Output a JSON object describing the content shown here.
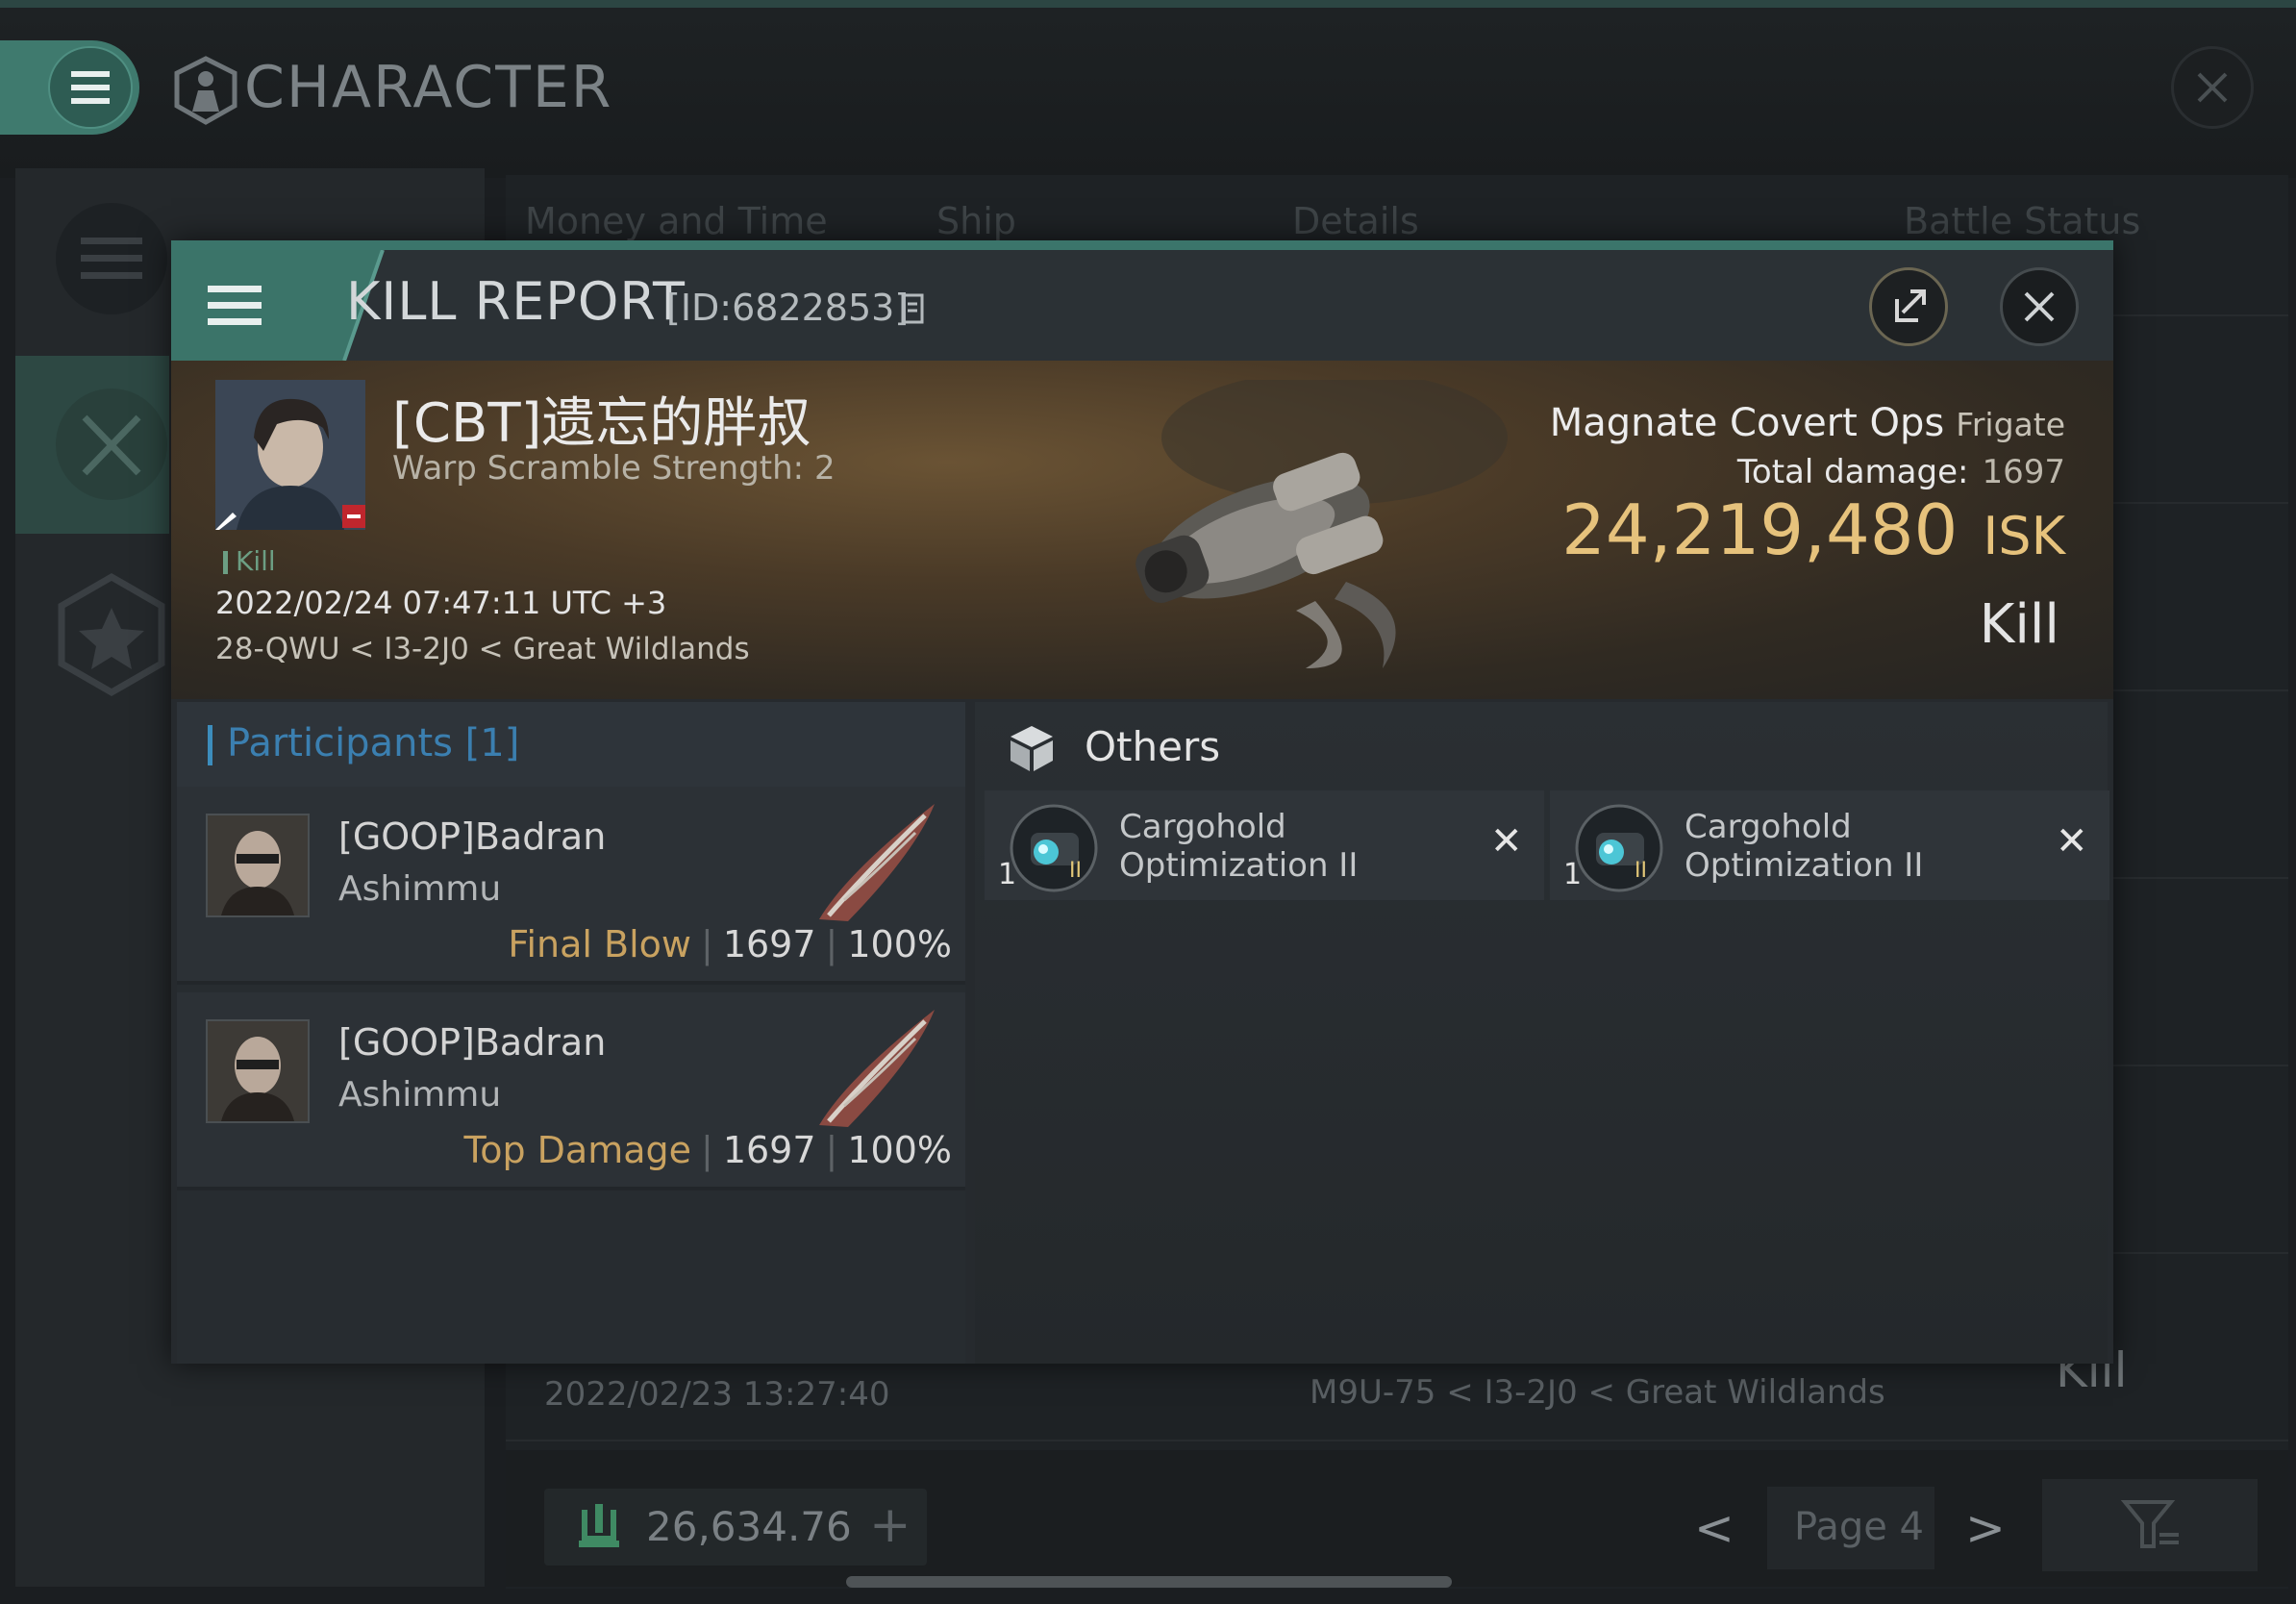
{
  "window": {
    "title": "CHARACTER",
    "tabs": [
      "Money and Time",
      "Ship",
      "Details",
      "Battle Status"
    ],
    "background_row": {
      "date": "2022/02/23  13:27:40",
      "location": "M9U-75 < I3-2J0 < Great Wildlands",
      "result": "Kill"
    },
    "wallet": {
      "amount": "26,634.76",
      "add_label": "+"
    },
    "pagination": {
      "prev": "<",
      "page": "Page 4",
      "next": ">"
    }
  },
  "kill_report": {
    "title": "KILL REPORT",
    "id": "[ID:6822853]",
    "victim": {
      "name": "[CBT]遗忘的胖叔",
      "warp_scramble": "Warp Scramble Strength: 2",
      "tag": "Kill",
      "datetime": "2022/02/24 07:47:11 UTC +3",
      "location": "28-QWU < I3-2J0 < Great Wildlands"
    },
    "ship": {
      "name": "Magnate Covert Ops",
      "class": "Frigate",
      "total_damage_label": "Total damage:",
      "total_damage": "1697",
      "isk_value": "24,219,480",
      "isk_unit": "ISK",
      "result": "Kill"
    },
    "participants": {
      "title": "Participants [1]",
      "rows": [
        {
          "name": "[GOOP]Badran",
          "ship": "Ashimmu",
          "role": "Final Blow",
          "damage": "1697",
          "percent": "100%"
        },
        {
          "name": "[GOOP]Badran",
          "ship": "Ashimmu",
          "role": "Top Damage",
          "damage": "1697",
          "percent": "100%"
        }
      ]
    },
    "others": {
      "title": "Others",
      "items": [
        {
          "qty": "1",
          "name": "Cargohold Optimization II",
          "tier": "II"
        },
        {
          "qty": "1",
          "name": "Cargohold Optimization II",
          "tier": "II"
        }
      ]
    }
  },
  "colors": {
    "accent_teal": "#3b7469",
    "isk_gold": "#e6c27c",
    "role_gold": "#c9a260",
    "participants_blue": "#3b7fb0"
  },
  "icons": [
    "menu-icon",
    "character-icon",
    "close-icon",
    "copy-icon",
    "share-icon",
    "cube-icon",
    "cargohold-module-icon",
    "remove-icon",
    "wallet-icon",
    "filter-icon",
    "combat-icon",
    "star-icon"
  ]
}
